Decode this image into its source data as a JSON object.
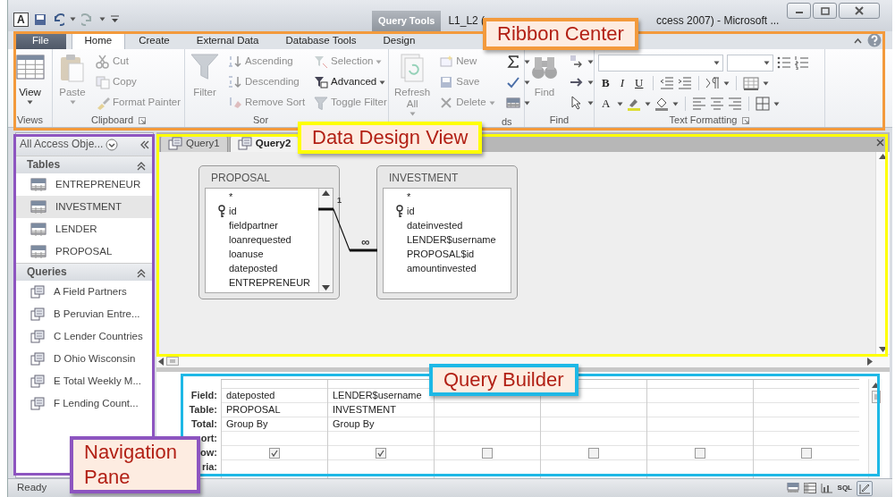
{
  "title_bar": {
    "app_letter": "A",
    "contextual_tab": "Query Tools",
    "title_start": "L1_L2 (",
    "title_end": "ccess 2007) - Microsoft ..."
  },
  "ribbon": {
    "tabs": [
      {
        "label": "File",
        "selected": false
      },
      {
        "label": "Home",
        "selected": true
      },
      {
        "label": "Create",
        "selected": false
      },
      {
        "label": "External Data",
        "selected": false
      },
      {
        "label": "Database Tools",
        "selected": false
      },
      {
        "label": "Design",
        "selected": false
      }
    ],
    "groups": [
      {
        "label": "Views",
        "big": {
          "label": "View",
          "disabled": false,
          "menu": true
        }
      },
      {
        "label": "Clipboard",
        "big": {
          "label": "Paste",
          "disabled": true,
          "menu": true
        },
        "small": [
          {
            "label": "Cut",
            "disabled": true,
            "menu": false
          },
          {
            "label": "Copy",
            "disabled": true,
            "menu": false
          },
          {
            "label": "Format Painter",
            "disabled": true,
            "menu": false
          }
        ]
      },
      {
        "label": "Sor",
        "big": {
          "label": "Filter",
          "disabled": true,
          "menu": false
        },
        "small": [
          {
            "label": "Ascending",
            "disabled": true,
            "menu": false
          },
          {
            "label": "Descending",
            "disabled": true,
            "menu": false
          },
          {
            "label": "Remove Sort",
            "disabled": true,
            "menu": false
          },
          {
            "label": "Selection",
            "disabled": true,
            "menu": true
          },
          {
            "label": "Advanced",
            "disabled": false,
            "menu": true
          },
          {
            "label": "Toggle Filter",
            "disabled": true,
            "menu": false
          }
        ]
      },
      {
        "label": "ds",
        "big": {
          "label": "Refresh All",
          "disabled": true,
          "menu": true
        },
        "small": [
          {
            "label": "New",
            "disabled": true,
            "menu": false
          },
          {
            "label": "Save",
            "disabled": true,
            "menu": false
          },
          {
            "label": "Delete",
            "disabled": true,
            "menu": true
          }
        ]
      },
      {
        "label": "Find",
        "big": {
          "label": "Find",
          "disabled": true,
          "menu": false
        }
      },
      {
        "label": "Text Formatting",
        "format_buttons": [
          "B",
          "I",
          "U"
        ],
        "font_color": "A"
      }
    ]
  },
  "navigation": {
    "header": "All Access Obje...",
    "sections": [
      {
        "title": "Tables",
        "kind": "table",
        "items": [
          {
            "label": "ENTREPRENEUR",
            "selected": false
          },
          {
            "label": "INVESTMENT",
            "selected": true
          },
          {
            "label": "LENDER",
            "selected": false
          },
          {
            "label": "PROPOSAL",
            "selected": false
          }
        ]
      },
      {
        "title": "Queries",
        "kind": "query",
        "items": [
          {
            "label": "A Field Partners",
            "selected": false
          },
          {
            "label": "B Peruvian Entre...",
            "selected": false
          },
          {
            "label": "C Lender Countries",
            "selected": false
          },
          {
            "label": "D Ohio Wisconsin",
            "selected": false
          },
          {
            "label": "E Total Weekly M...",
            "selected": false
          },
          {
            "label": "F Lending Count...",
            "selected": false
          }
        ]
      }
    ]
  },
  "design_view": {
    "tabs": [
      {
        "label": "Query1",
        "selected": false
      },
      {
        "label": "Query2",
        "selected": true
      }
    ],
    "tables": [
      {
        "name": "PROPOSAL",
        "scrollbar": true,
        "fields": [
          {
            "name": "*",
            "key": false
          },
          {
            "name": "id",
            "key": true
          },
          {
            "name": "fieldpartner",
            "key": false
          },
          {
            "name": "loanrequested",
            "key": false
          },
          {
            "name": "loanuse",
            "key": false
          },
          {
            "name": "dateposted",
            "key": false
          },
          {
            "name": "ENTREPRENEUR",
            "key": false
          }
        ]
      },
      {
        "name": "INVESTMENT",
        "scrollbar": false,
        "fields": [
          {
            "name": "*",
            "key": false
          },
          {
            "name": "id",
            "key": true
          },
          {
            "name": "dateinvested",
            "key": false
          },
          {
            "name": "LENDER$username",
            "key": false
          },
          {
            "name": "PROPOSAL$id",
            "key": false
          },
          {
            "name": "amountinvested",
            "key": false
          }
        ]
      }
    ],
    "relationship": {
      "one": "1",
      "many": "∞"
    }
  },
  "query_grid": {
    "row_labels": [
      "Field:",
      "Table:",
      "Total:",
      "ort:",
      "ow:",
      "ria:"
    ],
    "columns": [
      {
        "field": "dateposted",
        "table": "PROPOSAL",
        "total": "Group By",
        "show": true
      },
      {
        "field": "LENDER$username",
        "table": "INVESTMENT",
        "total": "Group By",
        "show": true
      },
      {
        "show": false
      },
      {
        "show": false
      },
      {
        "show": false
      },
      {
        "show": false
      }
    ]
  },
  "status_bar": {
    "status": "Ready",
    "sql": "SQL"
  },
  "callouts": [
    {
      "label": "Ribbon Center",
      "color": "#f39a3c"
    },
    {
      "label": "Data Design View",
      "color": "#ffff00"
    },
    {
      "label": "Query Builder",
      "color": "#1eb8e6"
    },
    {
      "label": "Navigation Pane",
      "color": "#8d55c0"
    }
  ]
}
